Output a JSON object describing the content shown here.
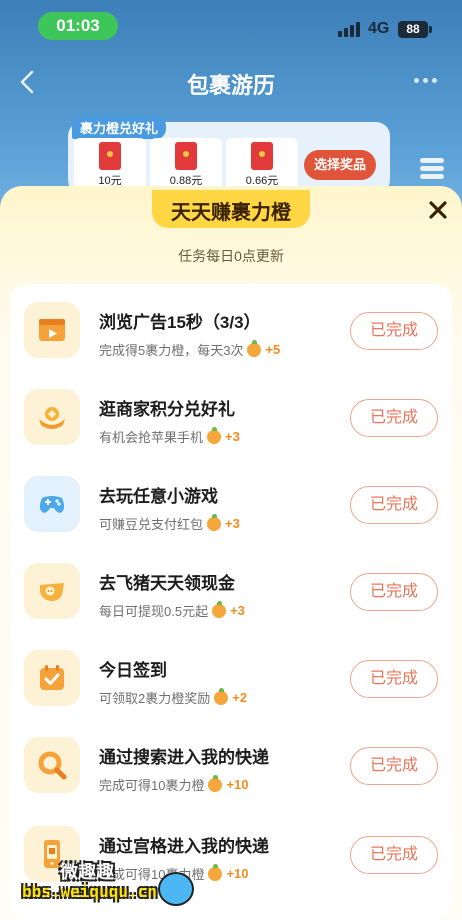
{
  "status_bar": {
    "time": "01:03",
    "network": "4G",
    "battery": "88"
  },
  "nav": {
    "title": "包裹游历"
  },
  "exchange": {
    "tag": "裹力橙兑好礼",
    "prizes": [
      {
        "value": "10元"
      },
      {
        "value": "0.88元"
      },
      {
        "value": "0.66元"
      }
    ],
    "choose_label": "选择奖品"
  },
  "sheet": {
    "title": "天天赚裹力橙",
    "subtitle": "任务每日0点更新"
  },
  "tasks": [
    {
      "title": "浏览广告15秒（3/3）",
      "desc": "完成得5裹力橙，每天3次",
      "reward": "+5",
      "button": "已完成",
      "icon": "video-icon"
    },
    {
      "title": "逛商家积分兑好礼",
      "desc": "有机会抢苹果手机",
      "reward": "+3",
      "button": "已完成",
      "icon": "gold-ingot-icon"
    },
    {
      "title": "去玩任意小游戏",
      "desc": "可赚豆兑支付红包",
      "reward": "+3",
      "button": "已完成",
      "icon": "gamepad-icon"
    },
    {
      "title": "去飞猪天天领现金",
      "desc": "每日可提现0.5元起",
      "reward": "+3",
      "button": "已完成",
      "icon": "fliggy-pig-icon"
    },
    {
      "title": "今日签到",
      "desc": "可领取2裹力橙奖励",
      "reward": "+2",
      "button": "已完成",
      "icon": "calendar-check-icon"
    },
    {
      "title": "通过搜索进入我的快递",
      "desc": "完成可得10裹力橙",
      "reward": "+10",
      "button": "已完成",
      "icon": "search-icon"
    },
    {
      "title": "通过宫格进入我的快递",
      "desc": "完成可得10裹力橙",
      "reward": "+10",
      "button": "已完成",
      "icon": "phone-package-icon"
    }
  ],
  "watermark": {
    "line1": "微趣趣",
    "line2": "bbs.weiququ.cn"
  }
}
